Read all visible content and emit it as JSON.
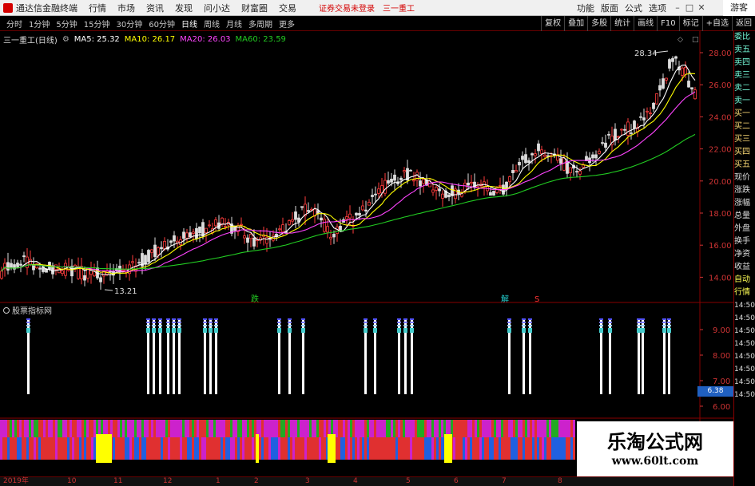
{
  "titlebar": {
    "app_title": "通达信金融终端",
    "menu": [
      "行情",
      "市场",
      "资讯",
      "发现",
      "问小达",
      "财富圈",
      "交易"
    ],
    "login_status": "证券交易未登录",
    "stock_tab": "三一重工",
    "right_menu": [
      "功能",
      "版面",
      "公式",
      "选项"
    ],
    "guest": "游客"
  },
  "toolbar": {
    "periods": [
      "分时",
      "1分钟",
      "5分钟",
      "15分钟",
      "30分钟",
      "60分钟",
      "日线",
      "周线",
      "月线",
      "多周期",
      "更多"
    ],
    "active_period": "日线",
    "buttons": [
      "复权",
      "叠加",
      "多股",
      "统计",
      "画线",
      "F10",
      "标记",
      "+自选",
      "返回"
    ]
  },
  "chart_info": {
    "stock": "三一重工(日线)",
    "ma5": "MA5: 25.32",
    "ma10": "MA10: 26.17",
    "ma20": "MA20: 26.03",
    "ma60": "MA60: 23.59",
    "colors": {
      "ma5": "#ffffff",
      "ma10": "#ffff00",
      "ma20": "#ff44ff",
      "ma60": "#22cc22"
    }
  },
  "annotations": {
    "high_label": "28.34",
    "low_label": "13.21",
    "mark_die": "跌",
    "mark_jie": "解",
    "mark_s": "S"
  },
  "price_axis": [
    "28.00",
    "26.00",
    "24.00",
    "22.00",
    "20.00",
    "18.00",
    "16.00",
    "14.00"
  ],
  "indicator": {
    "name": "股票指标网",
    "axis": [
      "9.00",
      "8.00",
      "7.00",
      "6.00"
    ],
    "current_value": "6.38"
  },
  "quote_panel": {
    "rows": [
      "委比",
      "卖五",
      "卖四",
      "卖三",
      "卖二",
      "卖一",
      "买一",
      "买二",
      "买三",
      "买四",
      "买五",
      "现价",
      "涨跌",
      "涨幅",
      "总量",
      "外盘",
      "换手",
      "净资",
      "收益"
    ],
    "tabs": [
      "自动",
      "行情"
    ],
    "times": [
      "14:50",
      "14:50",
      "14:50",
      "14:50",
      "14:50",
      "14:50",
      "14:50",
      "14:50"
    ]
  },
  "date_axis": [
    "2019年",
    "10",
    "11",
    "12",
    "1",
    "2",
    "3",
    "4",
    "5",
    "6",
    "7",
    "8"
  ],
  "watermark": {
    "title": "乐淘公式网",
    "url": "www.60lt.com"
  }
}
